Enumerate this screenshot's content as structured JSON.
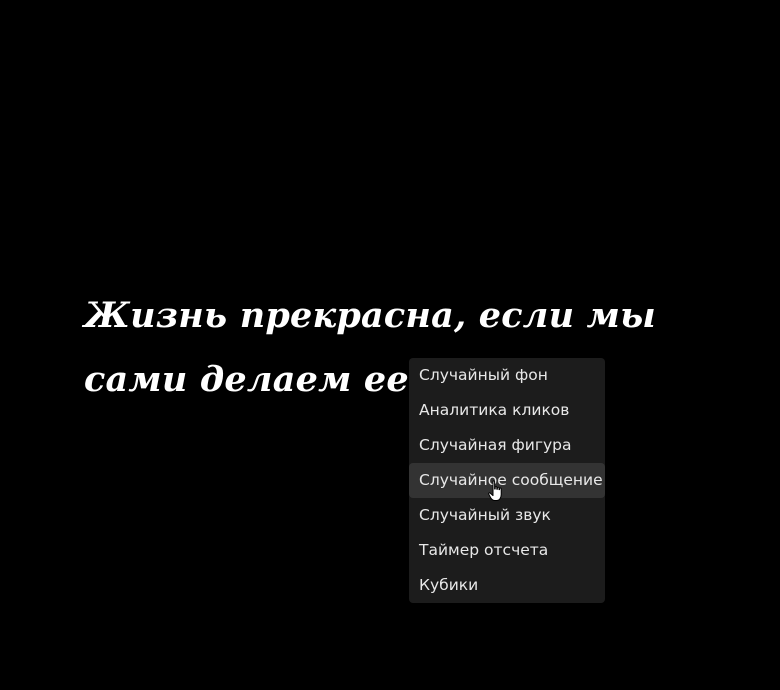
{
  "quote": {
    "text": "Жизнь прекрасна, если мы сами делаем ее такой."
  },
  "context_menu": {
    "items": [
      {
        "label": "Случайный фон"
      },
      {
        "label": "Аналитика кликов"
      },
      {
        "label": "Случайная фигура"
      },
      {
        "label": "Случайное сообщение",
        "hovered": true
      },
      {
        "label": "Случайный звук"
      },
      {
        "label": "Таймер отсчета"
      },
      {
        "label": "Кубики"
      }
    ]
  },
  "cursor": {
    "icon": "hand-pointer-icon"
  },
  "colors": {
    "background": "#000000",
    "text": "#ffffff",
    "menu_bg": "#1c1c1c",
    "menu_hover": "#333333"
  }
}
